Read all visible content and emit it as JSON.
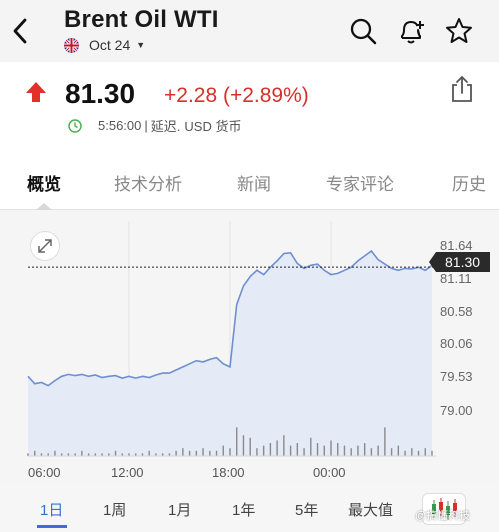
{
  "header": {
    "title": "Brent Oil WTI",
    "date_label": "Oct 24",
    "icons": [
      "back-icon",
      "uk-flag-icon",
      "chevron-down-icon",
      "search-icon",
      "bell-plus-icon",
      "star-icon"
    ]
  },
  "quote": {
    "price": "81.30",
    "change": "+2.28 (+2.89%)",
    "time": "5:56:00",
    "delay_label": "延迟.",
    "currency_label": "USD 货币",
    "colors": {
      "up": "#d6302a"
    }
  },
  "tabs": [
    {
      "label": "概览",
      "active": true
    },
    {
      "label": "技术分析",
      "active": false
    },
    {
      "label": "新闻",
      "active": false
    },
    {
      "label": "专家评论",
      "active": false
    },
    {
      "label": "历史",
      "active": false
    }
  ],
  "chart_data": {
    "type": "area",
    "current_price_label": "81.30",
    "current_price": 81.3,
    "yticks": [
      "81.64",
      "81.11",
      "80.58",
      "80.06",
      "79.53",
      "79.00"
    ],
    "xticks": [
      "06:00",
      "12:00",
      "18:00",
      "00:00"
    ],
    "ylim": [
      78.8,
      81.8
    ],
    "x": [
      0,
      0.5,
      1,
      1.5,
      2,
      2.5,
      3,
      3.5,
      4,
      4.5,
      5,
      5.5,
      6,
      6.5,
      7,
      7.5,
      8,
      8.5,
      9,
      9.5,
      10,
      10.5,
      11,
      11.5,
      12,
      12.5,
      13,
      13.5,
      14,
      14.5,
      15,
      15.5,
      16,
      16.5,
      17,
      17.5,
      18,
      18.5,
      19,
      19.5,
      20,
      20.5,
      21,
      21.5,
      22,
      22.5,
      23,
      23.5,
      24,
      24.5,
      25,
      25.5,
      26,
      26.5,
      27,
      27.5,
      28,
      28.5,
      29,
      29.5,
      30
    ],
    "values": [
      79.55,
      79.43,
      79.45,
      79.4,
      79.48,
      79.55,
      79.58,
      79.56,
      79.58,
      79.55,
      79.57,
      79.53,
      79.55,
      79.56,
      79.52,
      79.55,
      79.52,
      79.55,
      79.53,
      79.57,
      79.6,
      79.6,
      79.65,
      79.7,
      79.75,
      79.8,
      79.78,
      79.82,
      79.85,
      79.75,
      79.7,
      80.7,
      81.0,
      81.15,
      81.25,
      81.18,
      81.3,
      81.4,
      81.52,
      81.53,
      81.36,
      81.28,
      81.33,
      81.35,
      81.25,
      81.18,
      81.2,
      81.25,
      81.3,
      81.4,
      81.48,
      81.56,
      81.42,
      81.35,
      81.28,
      81.25,
      81.28,
      81.27,
      81.3,
      81.25,
      81.33
    ],
    "volume": [
      1,
      2,
      1,
      1,
      2,
      1,
      1,
      1,
      2,
      1,
      1,
      1,
      1,
      2,
      1,
      1,
      1,
      1,
      2,
      1,
      1,
      1,
      2,
      3,
      2,
      2,
      3,
      2,
      2,
      4,
      3,
      11,
      8,
      7,
      3,
      4,
      5,
      6,
      8,
      4,
      5,
      3,
      7,
      5,
      4,
      6,
      5,
      4,
      3,
      4,
      5,
      3,
      4,
      11,
      3,
      4,
      2,
      3,
      2,
      3,
      2
    ],
    "grid": false,
    "colors": {
      "line": "#6f8fd0",
      "fill": "#e4eaf6"
    }
  },
  "periods": [
    {
      "label": "1日",
      "active": true
    },
    {
      "label": "1周",
      "active": false
    },
    {
      "label": "1月",
      "active": false
    },
    {
      "label": "1年",
      "active": false
    },
    {
      "label": "5年",
      "active": false
    },
    {
      "label": "最大值",
      "active": false
    }
  ],
  "watermark": "@搞懂科技",
  "accent": "#3b6fd8"
}
